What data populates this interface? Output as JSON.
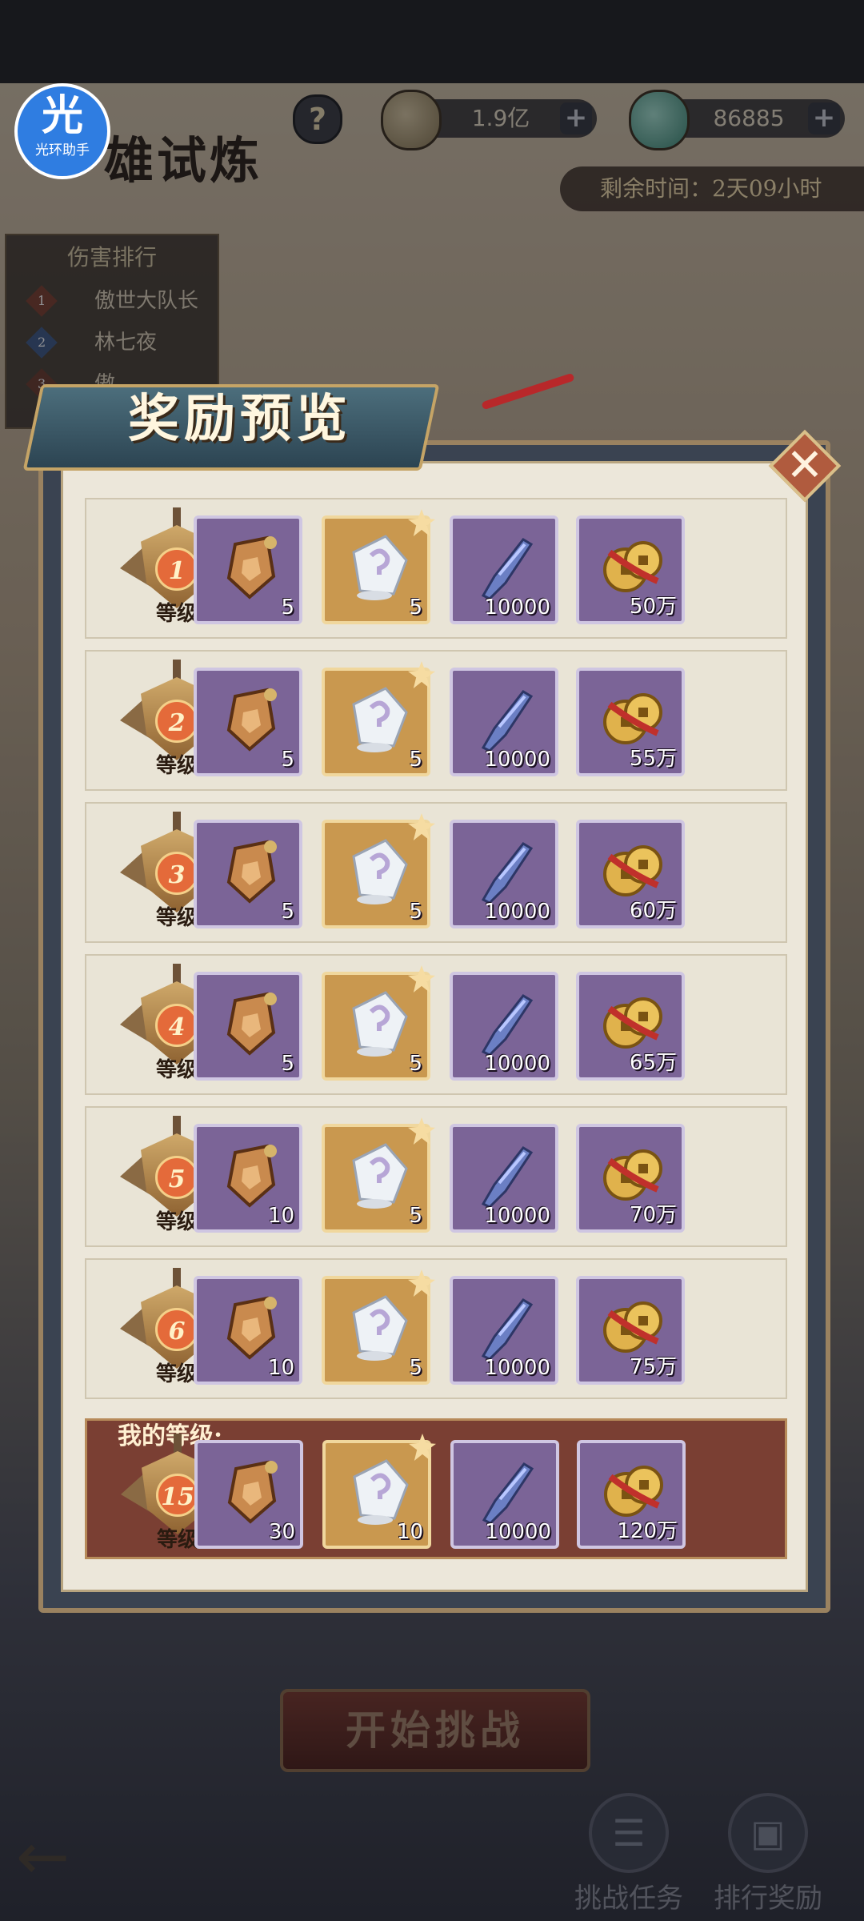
{
  "app_badge": {
    "glyph": "光",
    "label": "光环助手"
  },
  "header": {
    "title_fragment": "雄试炼",
    "help": "?",
    "currencies": [
      {
        "name": "copper-coin",
        "value": "1.9亿",
        "plus": "+"
      },
      {
        "name": "jade-coin",
        "value": "86885",
        "plus": "+"
      }
    ],
    "timer": "剩余时间：2天09小时"
  },
  "ranking": {
    "title": "伤害排行",
    "rows": [
      {
        "rank": "1",
        "name": "傲世大队长"
      },
      {
        "rank": "2",
        "name": "林七夜"
      },
      {
        "rank": "3",
        "name": "傲"
      }
    ]
  },
  "modal": {
    "title": "奖励预览",
    "close": "✕",
    "level_suffix": "等级",
    "my_level_label": "我的等级:",
    "rows": [
      {
        "level": "1",
        "items": [
          {
            "icon": "token-icon",
            "count": "5"
          },
          {
            "icon": "crystal-icon",
            "count": "5"
          },
          {
            "icon": "blade-icon",
            "count": "10000"
          },
          {
            "icon": "coins-icon",
            "count": "50万"
          }
        ]
      },
      {
        "level": "2",
        "items": [
          {
            "icon": "token-icon",
            "count": "5"
          },
          {
            "icon": "crystal-icon",
            "count": "5"
          },
          {
            "icon": "blade-icon",
            "count": "10000"
          },
          {
            "icon": "coins-icon",
            "count": "55万"
          }
        ]
      },
      {
        "level": "3",
        "items": [
          {
            "icon": "token-icon",
            "count": "5"
          },
          {
            "icon": "crystal-icon",
            "count": "5"
          },
          {
            "icon": "blade-icon",
            "count": "10000"
          },
          {
            "icon": "coins-icon",
            "count": "60万"
          }
        ]
      },
      {
        "level": "4",
        "items": [
          {
            "icon": "token-icon",
            "count": "5"
          },
          {
            "icon": "crystal-icon",
            "count": "5"
          },
          {
            "icon": "blade-icon",
            "count": "10000"
          },
          {
            "icon": "coins-icon",
            "count": "65万"
          }
        ]
      },
      {
        "level": "5",
        "items": [
          {
            "icon": "token-icon",
            "count": "10"
          },
          {
            "icon": "crystal-icon",
            "count": "5"
          },
          {
            "icon": "blade-icon",
            "count": "10000"
          },
          {
            "icon": "coins-icon",
            "count": "70万"
          }
        ]
      },
      {
        "level": "6",
        "items": [
          {
            "icon": "token-icon",
            "count": "10"
          },
          {
            "icon": "crystal-icon",
            "count": "5"
          },
          {
            "icon": "blade-icon",
            "count": "10000"
          },
          {
            "icon": "coins-icon",
            "count": "75万"
          }
        ]
      }
    ],
    "my_row": {
      "level": "15",
      "items": [
        {
          "icon": "token-icon",
          "count": "30"
        },
        {
          "icon": "crystal-icon",
          "count": "10"
        },
        {
          "icon": "blade-icon",
          "count": "10000"
        },
        {
          "icon": "coins-icon",
          "count": "120万"
        }
      ]
    }
  },
  "footer": {
    "start_button": "开始挑战",
    "back": "←",
    "challenge_tasks": "挑战任务",
    "rank_rewards": "排行奖励"
  },
  "colors": {
    "item_purple": "#7b6497",
    "item_gold": "#c9984f",
    "my_row": "#7a3f33",
    "panel": "#ece7da"
  }
}
